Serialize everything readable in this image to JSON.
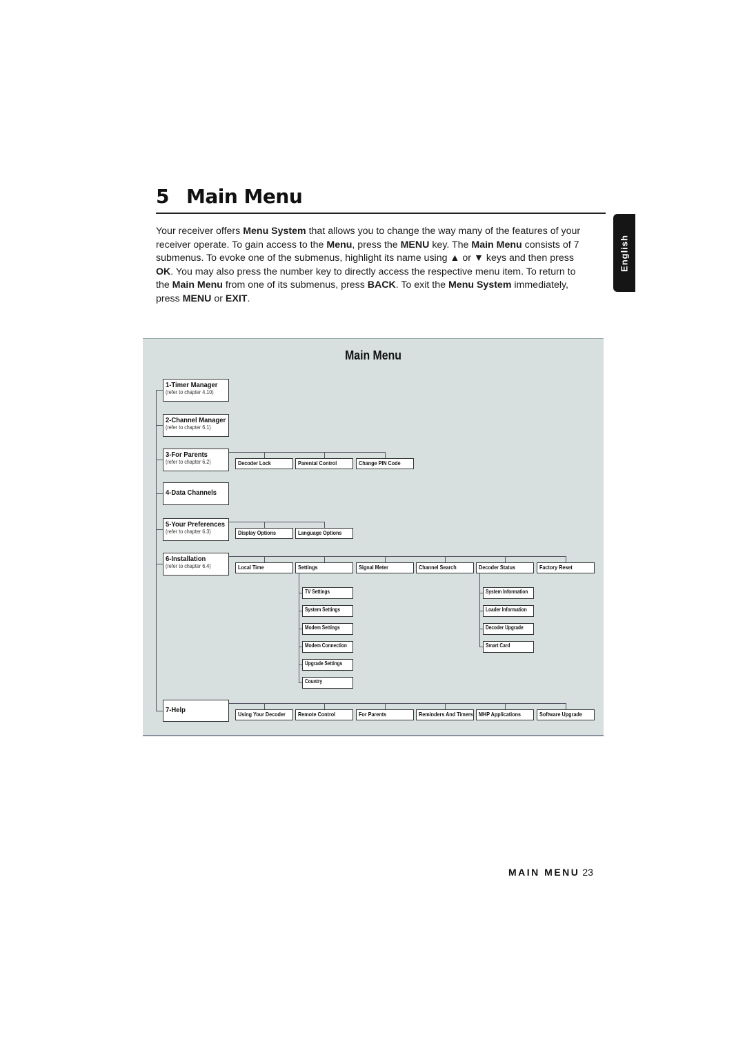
{
  "heading": {
    "number": "5",
    "title": "Main Menu"
  },
  "intro": [
    {
      "t": "Your receiver offers ",
      "b": false
    },
    {
      "t": "Menu System",
      "b": true
    },
    {
      "t": " that allows you to change the way many of the features of your receiver operate. To gain access to the ",
      "b": false
    },
    {
      "t": "Menu",
      "b": true
    },
    {
      "t": ", press the ",
      "b": false
    },
    {
      "t": "MENU",
      "b": true
    },
    {
      "t": " key. The ",
      "b": false
    },
    {
      "t": "Main Menu",
      "b": true
    },
    {
      "t": " consists of 7 submenus. To evoke one of the submenus, highlight its name using ▲ or ▼ keys and then press ",
      "b": false
    },
    {
      "t": "OK",
      "b": true
    },
    {
      "t": ". You may also press the number key to directly access the respective menu item. To return to the ",
      "b": false
    },
    {
      "t": "Main Menu",
      "b": true
    },
    {
      "t": " from one of its submenus, press ",
      "b": false
    },
    {
      "t": "BACK",
      "b": true
    },
    {
      "t": ". To exit the ",
      "b": false
    },
    {
      "t": "Menu System",
      "b": true
    },
    {
      "t": " immediately, press ",
      "b": false
    },
    {
      "t": "MENU",
      "b": true
    },
    {
      "t": " or ",
      "b": false
    },
    {
      "t": "EXIT",
      "b": true
    },
    {
      "t": ".",
      "b": false
    }
  ],
  "language_tab": "English",
  "diagram": {
    "title": "Main Menu",
    "menus": [
      {
        "label": "1-Timer Manager",
        "ref": "(refer to chapter 4.10)",
        "items": []
      },
      {
        "label": "2-Channel Manager",
        "ref": "(refer to chapter 6.1)",
        "items": []
      },
      {
        "label": "3-For Parents",
        "ref": "(refer to chapter 6.2)",
        "items": [
          {
            "label": "Decoder Lock"
          },
          {
            "label": "Parental Control"
          },
          {
            "label": "Change PIN Code"
          }
        ]
      },
      {
        "label": "4-Data Channels",
        "ref": "",
        "items": []
      },
      {
        "label": "5-Your Preferences",
        "ref": "(refer to chapter 6.3)",
        "items": [
          {
            "label": "Display Options"
          },
          {
            "label": "Language Options"
          }
        ]
      },
      {
        "label": "6-Installation",
        "ref": "(refer to chapter 6.4)",
        "items": [
          {
            "label": "Local Time"
          },
          {
            "label": "Settings",
            "children": [
              "TV Settings",
              "System Settings",
              "Modem Settings",
              "Modem Connection",
              "Upgrade Settings",
              "Country"
            ]
          },
          {
            "label": "Signal Meter"
          },
          {
            "label": "Channel Search"
          },
          {
            "label": "Decoder Status",
            "children": [
              "System Information",
              "Loader Information",
              "Decoder Upgrade",
              "Smart Card"
            ]
          },
          {
            "label": "Factory Reset"
          }
        ]
      },
      {
        "label": "7-Help",
        "ref": "",
        "items": [
          {
            "label": "Using Your Decoder"
          },
          {
            "label": "Remote Control"
          },
          {
            "label": "For Parents"
          },
          {
            "label": "Reminders And Timers"
          },
          {
            "label": "MHP Applications"
          },
          {
            "label": "Software Upgrade"
          }
        ]
      }
    ]
  },
  "footer": {
    "section": "MAIN MENU",
    "page": "23"
  }
}
